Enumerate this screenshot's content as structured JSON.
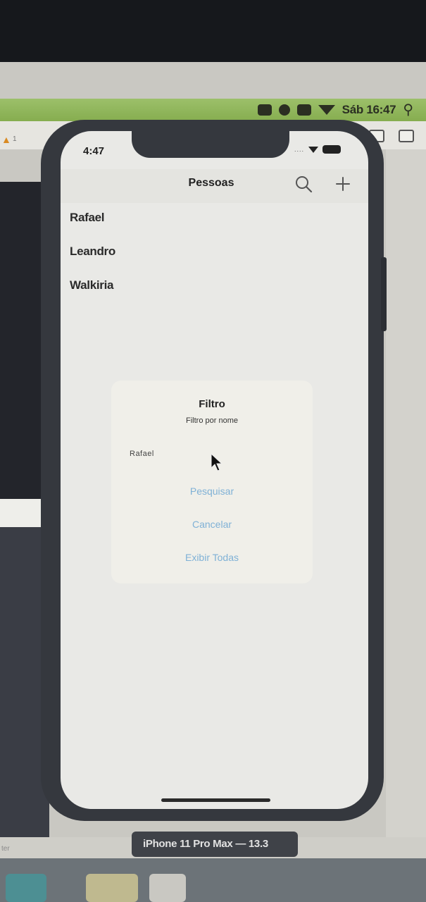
{
  "mac_menubar": {
    "clock": "Sáb 16:47",
    "icons": [
      "app-icon",
      "record-icon",
      "airplay-icon",
      "wifi-icon",
      "search-icon"
    ]
  },
  "xcode": {
    "warning_count": "1",
    "left_filter_text": "ter"
  },
  "status_bar": {
    "time": "4:47",
    "signal": "....",
    "icons": [
      "wifi-icon",
      "battery-icon"
    ]
  },
  "navbar": {
    "title": "Pessoas",
    "search_icon": "search-icon",
    "add_icon": "plus-icon"
  },
  "people": [
    {
      "name": "Rafael"
    },
    {
      "name": "Leandro"
    },
    {
      "name": "Walkiria"
    }
  ],
  "alert": {
    "title": "Filtro",
    "message": "Filtro por nome",
    "input_value": "Rafael",
    "buttons": [
      {
        "label": "Pesquisar"
      },
      {
        "label": "Cancelar"
      },
      {
        "label": "Exibir Todas"
      }
    ]
  },
  "simulator": {
    "device_label": "iPhone 11 Pro Max — 13.3"
  },
  "colors": {
    "menubar": "#9cc06a",
    "alert_button_text": "#7fb1d6",
    "device_frame": "#35383e"
  }
}
